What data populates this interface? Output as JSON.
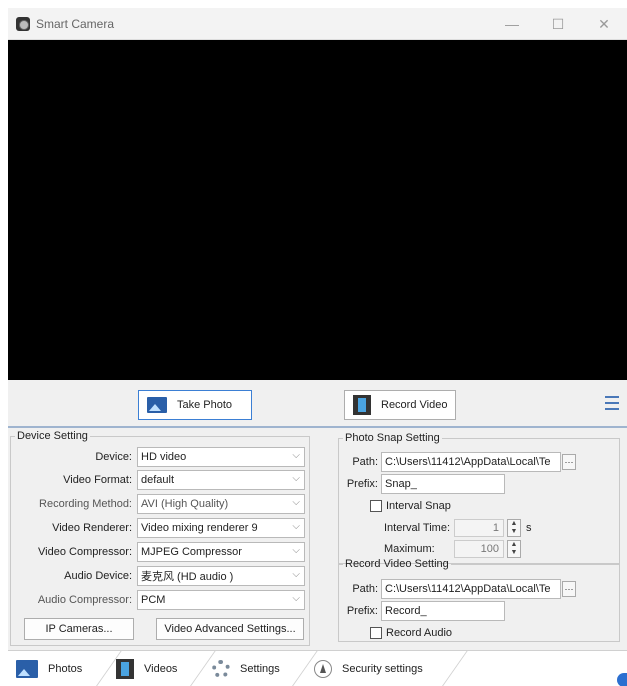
{
  "window": {
    "title": "Smart Camera",
    "minimize": "—",
    "maximize": "☐",
    "close": "✕"
  },
  "toolbar": {
    "take_photo": "Take Photo",
    "record_video": "Record Video"
  },
  "device_setting": {
    "legend": "Device Setting",
    "rows": [
      {
        "label": "Device:",
        "value": "HD video"
      },
      {
        "label": "Video Format:",
        "value": "default"
      },
      {
        "label": "Recording Method:",
        "value": "AVI (High Quality)"
      },
      {
        "label": "Video Renderer:",
        "value": "Video mixing renderer 9"
      },
      {
        "label": "Video Compressor:",
        "value": "MJPEG Compressor"
      },
      {
        "label": "Audio Device:",
        "value": "麦克风 (HD audio )"
      },
      {
        "label": "Audio Compressor:",
        "value": "PCM"
      }
    ],
    "ip_cameras": "IP Cameras...",
    "advanced": "Video Advanced Settings..."
  },
  "photo_snap": {
    "legend": "Photo Snap Setting",
    "path_label": "Path:",
    "path_value": "C:\\Users\\11412\\AppData\\Local\\Te",
    "prefix_label": "Prefix:",
    "prefix_value": "Snap_",
    "interval_snap": "Interval Snap",
    "interval_time_label": "Interval Time:",
    "interval_time_value": "1",
    "interval_unit": "s",
    "maximum_label": "Maximum:",
    "maximum_value": "100"
  },
  "record_video": {
    "legend": "Record Video Setting",
    "path_label": "Path:",
    "path_value": "C:\\Users\\11412\\AppData\\Local\\Te",
    "prefix_label": "Prefix:",
    "prefix_value": "Record_",
    "record_audio": "Record Audio"
  },
  "tabs": [
    {
      "label": "Photos"
    },
    {
      "label": "Videos"
    },
    {
      "label": "Settings"
    },
    {
      "label": "Security settings"
    }
  ],
  "ellipsis": "···",
  "combo_arrow": "⌵",
  "colors": {
    "accent": "#3b7fd4",
    "video_bg": "#000000",
    "panel_bg": "#f0f0f0"
  }
}
